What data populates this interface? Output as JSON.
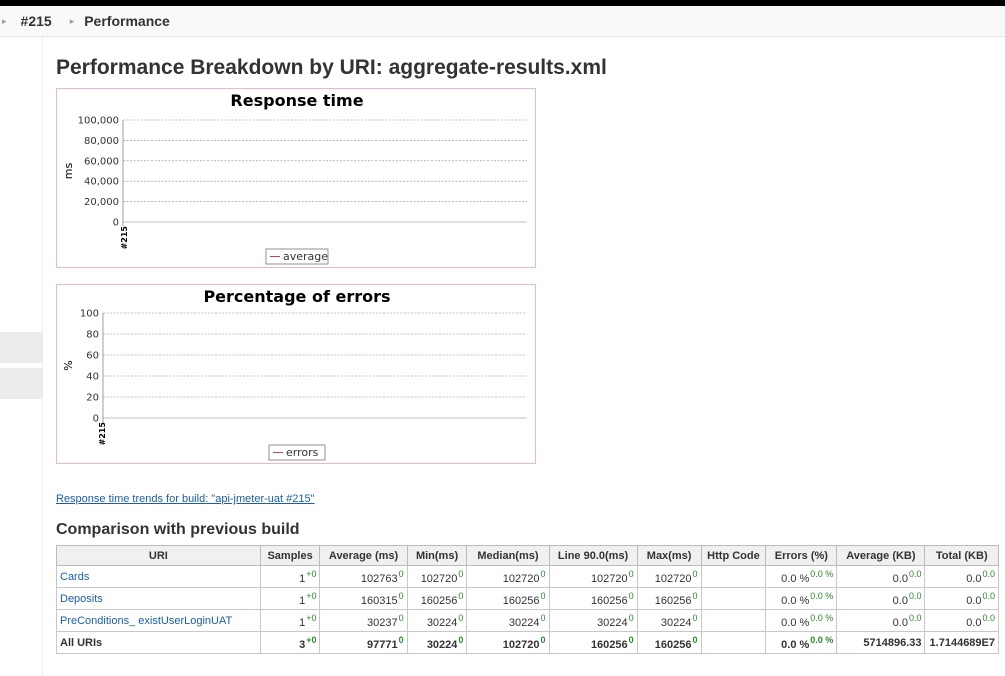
{
  "breadcrumb": {
    "build": "#215",
    "page": "Performance"
  },
  "page_title": "Performance Breakdown by URI: aggregate-results.xml",
  "charts": [
    {
      "chart_data": {
        "type": "line",
        "title": "Response time",
        "ylabel": "ms",
        "x": [
          "#215"
        ],
        "yticks": [
          "100,000",
          "80,000",
          "60,000",
          "40,000",
          "20,000",
          "0"
        ],
        "ylim": [
          0,
          100000
        ],
        "grid": true,
        "legend_placement": "bottom",
        "series": [
          {
            "name": "average",
            "values": []
          }
        ]
      }
    },
    {
      "chart_data": {
        "type": "line",
        "title": "Percentage of errors",
        "ylabel": "%",
        "x": [
          "#215"
        ],
        "yticks": [
          "100",
          "80",
          "60",
          "40",
          "20",
          "0"
        ],
        "ylim": [
          0,
          100
        ],
        "grid": true,
        "legend_placement": "bottom",
        "series": [
          {
            "name": "errors",
            "values": []
          }
        ]
      }
    }
  ],
  "trend_link": "Response time trends for build: \"api-jmeter-uat #215\"",
  "comparison": {
    "title": "Comparison with previous build",
    "headers": [
      "URI",
      "Samples",
      "Average (ms)",
      "Min(ms)",
      "Median(ms)",
      "Line 90.0(ms)",
      "Max(ms)",
      "Http Code",
      "Errors (%)",
      "Average (KB)",
      "Total (KB)"
    ],
    "rows": [
      {
        "uri": "Cards",
        "samples": "1",
        "samples_d": "+0",
        "avg": "102763",
        "avg_d": "0",
        "min": "102720",
        "min_d": "0",
        "median": "102720",
        "median_d": "0",
        "line90": "102720",
        "line90_d": "0",
        "max": "102720",
        "max_d": "0",
        "http": "",
        "errors": "0.0 %",
        "errors_d": "0.0 %",
        "avg_kb": "0.0",
        "avg_kb_d": "0.0",
        "total_kb": "0.0",
        "total_kb_d": "0.0"
      },
      {
        "uri": "Deposits",
        "samples": "1",
        "samples_d": "+0",
        "avg": "160315",
        "avg_d": "0",
        "min": "160256",
        "min_d": "0",
        "median": "160256",
        "median_d": "0",
        "line90": "160256",
        "line90_d": "0",
        "max": "160256",
        "max_d": "0",
        "http": "",
        "errors": "0.0 %",
        "errors_d": "0.0 %",
        "avg_kb": "0.0",
        "avg_kb_d": "0.0",
        "total_kb": "0.0",
        "total_kb_d": "0.0"
      },
      {
        "uri": "PreConditions_ existUserLoginUAT",
        "samples": "1",
        "samples_d": "+0",
        "avg": "30237",
        "avg_d": "0",
        "min": "30224",
        "min_d": "0",
        "median": "30224",
        "median_d": "0",
        "line90": "30224",
        "line90_d": "0",
        "max": "30224",
        "max_d": "0",
        "http": "",
        "errors": "0.0 %",
        "errors_d": "0.0 %",
        "avg_kb": "0.0",
        "avg_kb_d": "0.0",
        "total_kb": "0.0",
        "total_kb_d": "0.0"
      }
    ],
    "total": {
      "uri": "All URIs",
      "samples": "3",
      "samples_d": "+0",
      "avg": "97771",
      "avg_d": "0",
      "min": "30224",
      "min_d": "0",
      "median": "102720",
      "median_d": "0",
      "line90": "160256",
      "line90_d": "0",
      "max": "160256",
      "max_d": "0",
      "http": "",
      "errors": "0.0 %",
      "errors_d": "0.0 %",
      "avg_kb": "5714896.33",
      "total_kb": "1.7144689E7"
    }
  },
  "colors": {
    "link": "#1a5fa8",
    "delta": "#2a8a2a",
    "chart_border": "#e8b8d8",
    "series_line": "#cc4444"
  }
}
